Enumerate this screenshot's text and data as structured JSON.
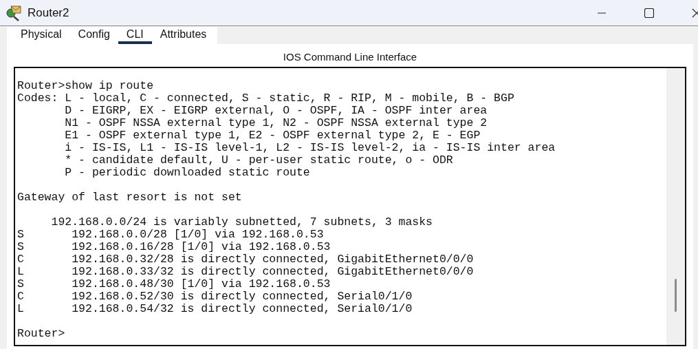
{
  "window": {
    "title": "Router2"
  },
  "tabs": [
    {
      "label": "Physical",
      "selected": false
    },
    {
      "label": "Config",
      "selected": false
    },
    {
      "label": "CLI",
      "selected": true
    },
    {
      "label": "Attributes",
      "selected": false
    }
  ],
  "panel_title": "IOS Command Line Interface",
  "terminal": {
    "blocks": [
      [
        "Router>show ip route",
        "Codes: L - local, C - connected, S - static, R - RIP, M - mobile, B - BGP",
        "       D - EIGRP, EX - EIGRP external, O - OSPF, IA - OSPF inter area",
        "       N1 - OSPF NSSA external type 1, N2 - OSPF NSSA external type 2",
        "       E1 - OSPF external type 1, E2 - OSPF external type 2, E - EGP",
        "       i - IS-IS, L1 - IS-IS level-1, L2 - IS-IS level-2, ia - IS-IS inter area",
        "       * - candidate default, U - per-user static route, o - ODR",
        "       P - periodic downloaded static route"
      ],
      [
        "Gateway of last resort is not set"
      ],
      [
        "     192.168.0.0/24 is variably subnetted, 7 subnets, 3 masks",
        "S       192.168.0.0/28 [1/0] via 192.168.0.53",
        "S       192.168.0.16/28 [1/0] via 192.168.0.53",
        "C       192.168.0.32/28 is directly connected, GigabitEthernet0/0/0",
        "L       192.168.0.33/32 is directly connected, GigabitEthernet0/0/0",
        "S       192.168.0.48/30 [1/0] via 192.168.0.53",
        "C       192.168.0.52/30 is directly connected, Serial0/1/0",
        "L       192.168.0.54/32 is directly connected, Serial0/1/0"
      ],
      [
        "Router>"
      ]
    ]
  }
}
